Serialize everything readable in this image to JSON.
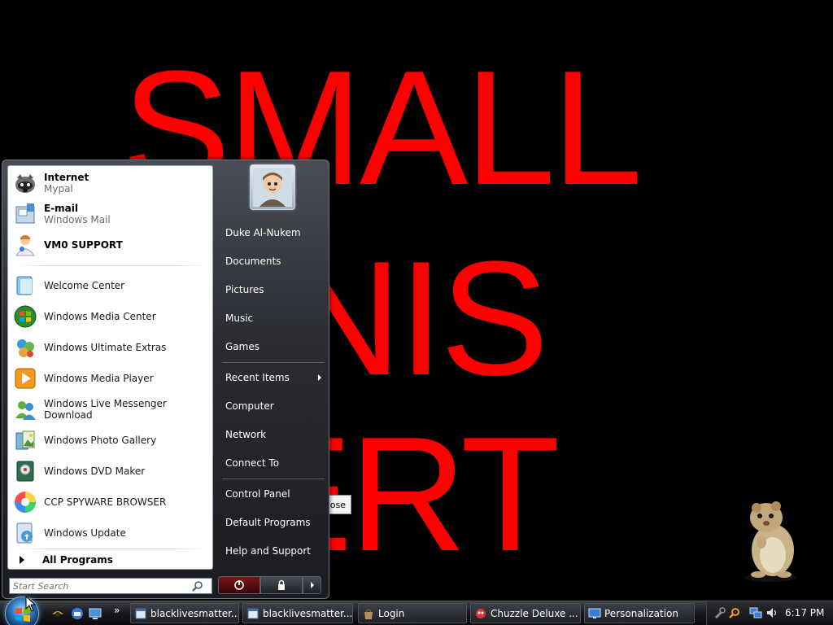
{
  "desktop": {
    "banner_line1": "SMALL",
    "banner_line2": "ENIS",
    "banner_line3": "ERT",
    "hidden_button_label": "ose"
  },
  "start_menu": {
    "pinned": [
      {
        "title": "Internet",
        "subtitle": "Mypal",
        "icon": "raccoon-browser-icon"
      },
      {
        "title": "E-mail",
        "subtitle": "Windows Mail",
        "icon": "mail-icon"
      },
      {
        "title": "VM0 SUPPORT",
        "subtitle": "",
        "icon": "support-person-icon"
      }
    ],
    "programs": [
      {
        "label": "Welcome Center",
        "icon": "welcome-center-icon"
      },
      {
        "label": "Windows Media Center",
        "icon": "media-center-icon"
      },
      {
        "label": "Windows Ultimate Extras",
        "icon": "ultimate-extras-icon"
      },
      {
        "label": "Windows Media Player",
        "icon": "media-player-icon"
      },
      {
        "label": "Windows Live Messenger Download",
        "icon": "messenger-icon"
      },
      {
        "label": "Windows Photo Gallery",
        "icon": "photo-gallery-icon"
      },
      {
        "label": "Windows DVD Maker",
        "icon": "dvd-maker-icon"
      },
      {
        "label": "CCP SPYWARE BROWSER",
        "icon": "color-wheel-icon"
      },
      {
        "label": "Windows Update",
        "icon": "windows-update-icon"
      }
    ],
    "all_programs": "All Programs",
    "search_placeholder": "Start Search",
    "right": {
      "user": "Duke Al-Nukem",
      "documents": "Documents",
      "pictures": "Pictures",
      "music": "Music",
      "games": "Games",
      "recent_items": "Recent Items",
      "computer": "Computer",
      "network": "Network",
      "connect_to": "Connect To",
      "control_panel": "Control Panel",
      "default_programs": "Default Programs",
      "help_support": "Help and Support"
    }
  },
  "taskbar": {
    "tasks": [
      {
        "label": "blacklivesmatter...",
        "icon": "document-window-icon"
      },
      {
        "label": "blacklivesmatter...",
        "icon": "document-window-icon"
      },
      {
        "label": "Login",
        "icon": "bag-icon"
      },
      {
        "label": "Chuzzle Deluxe ...",
        "icon": "chuzzle-icon"
      },
      {
        "label": "Personalization",
        "icon": "monitor-icon"
      }
    ],
    "quick_launch_more": "»",
    "clock": "6:17 PM"
  },
  "colors": {
    "banner_red": "#ff0000",
    "desktop_bg": "#000000"
  }
}
